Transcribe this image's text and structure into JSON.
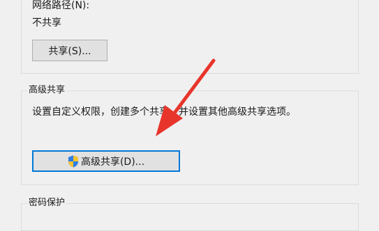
{
  "network_path": {
    "label": "网络路径(N):",
    "value": "不共享",
    "share_button": "共享(S)..."
  },
  "advanced_sharing": {
    "group_title": "高级共享",
    "description": "设置自定义权限，创建多个共享，并设置其他高级共享选项。",
    "button_label": "高级共享(D)..."
  },
  "password_protection": {
    "group_title": "密码保护"
  },
  "annotation": {
    "arrow_color": "#e8352b"
  },
  "icons": {
    "shield": "uac-shield-icon"
  }
}
